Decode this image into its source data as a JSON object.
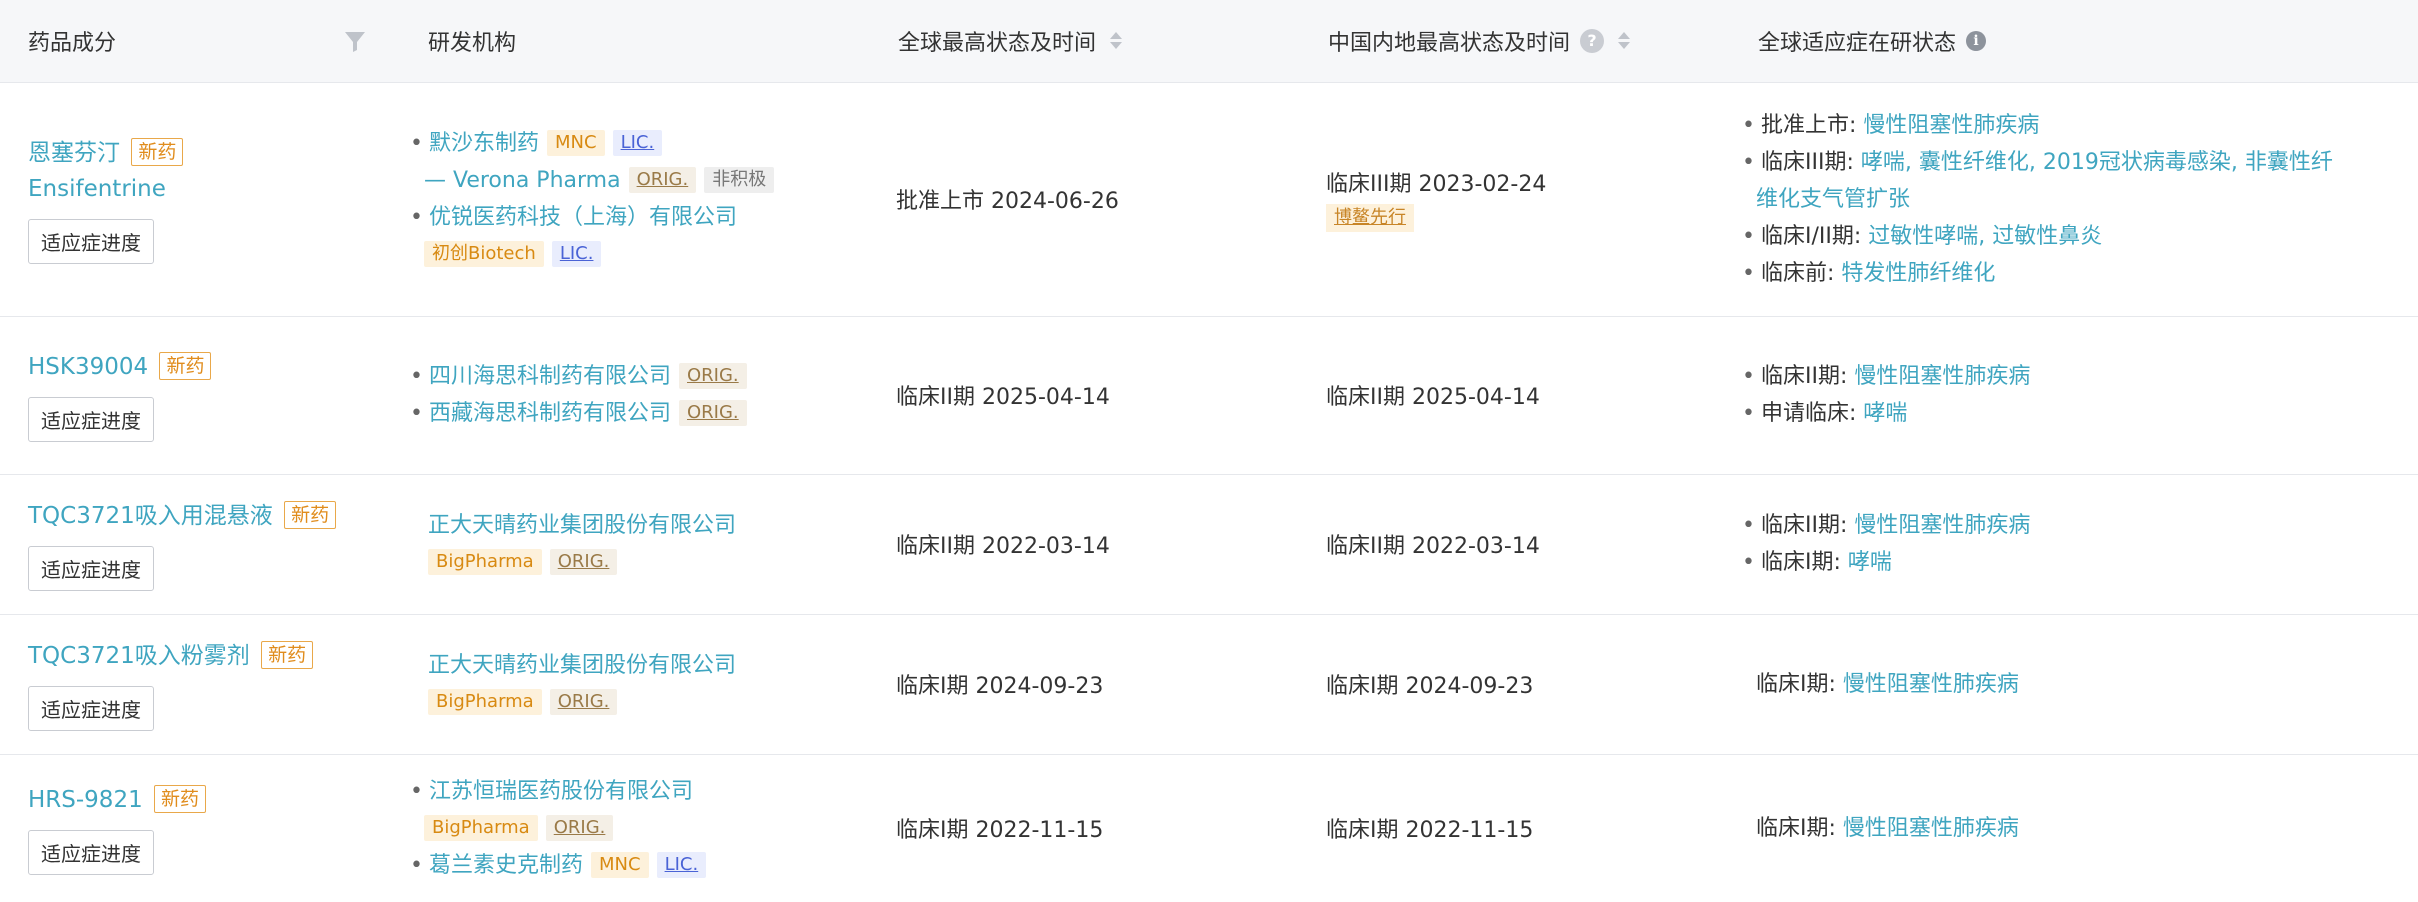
{
  "headers": {
    "drug": "药品成分",
    "org": "研发机构",
    "global_status": "全球最高状态及时间",
    "cn_status": "中国内地最高状态及时间",
    "indication": "全球适应症在研状态"
  },
  "progress_button": "适应症进度",
  "rows": [
    {
      "drug": "恩塞芬汀",
      "drug_en": "Ensifentrine",
      "new_badge": "新药",
      "orgs": [
        {
          "name": "默沙东制药",
          "tags": [
            "MNC",
            "LIC."
          ]
        },
        {
          "name": "— Verona Pharma",
          "tags": [
            "ORIG.",
            "非积极"
          ]
        },
        {
          "name": "优锐医药科技（上海）有限公司",
          "tags": []
        },
        {
          "name": "",
          "tags": [
            "初创Biotech",
            "LIC."
          ]
        }
      ],
      "global_status": "批准上市 2024-06-26",
      "cn_status": "临床III期 2023-02-24",
      "cn_tag": "博鳌先行",
      "indications": [
        {
          "label": "批准上市:",
          "diseases": [
            "慢性阻塞性肺疾病"
          ]
        },
        {
          "label": "临床III期:",
          "diseases": [
            "哮喘,",
            "囊性纤维化,",
            "2019冠状病毒感染,",
            "非囊性纤"
          ]
        },
        {
          "label": "",
          "diseases": [
            "维化支气管扩张"
          ]
        },
        {
          "label": "临床I/II期:",
          "diseases": [
            "过敏性哮喘,",
            "过敏性鼻炎"
          ]
        },
        {
          "label": "临床前:",
          "diseases": [
            "特发性肺纤维化"
          ]
        }
      ]
    },
    {
      "drug": "HSK39004",
      "new_badge": "新药",
      "orgs": [
        {
          "name": "四川海思科制药有限公司",
          "tags": [
            "ORIG."
          ]
        },
        {
          "name": "西藏海思科制药有限公司",
          "tags": [
            "ORIG."
          ]
        }
      ],
      "global_status": "临床II期 2025-04-14",
      "cn_status": "临床II期 2025-04-14",
      "indications": [
        {
          "label": "临床II期:",
          "diseases": [
            "慢性阻塞性肺疾病"
          ]
        },
        {
          "label": "申请临床:",
          "diseases": [
            "哮喘"
          ]
        }
      ]
    },
    {
      "drug": "TQC3721吸入用混悬液",
      "new_badge": "新药",
      "orgs": [
        {
          "name": "正大天晴药业集团股份有限公司",
          "tags": []
        },
        {
          "name": "",
          "tags": [
            "BigPharma",
            "ORIG."
          ]
        }
      ],
      "global_status": "临床II期 2022-03-14",
      "cn_status": "临床II期 2022-03-14",
      "indications": [
        {
          "label": "临床II期:",
          "diseases": [
            "慢性阻塞性肺疾病"
          ]
        },
        {
          "label": "临床I期:",
          "diseases": [
            "哮喘"
          ]
        }
      ]
    },
    {
      "drug": "TQC3721吸入粉雾剂",
      "new_badge": "新药",
      "orgs": [
        {
          "name": "正大天晴药业集团股份有限公司",
          "tags": []
        },
        {
          "name": "",
          "tags": [
            "BigPharma",
            "ORIG."
          ]
        }
      ],
      "global_status": "临床I期 2024-09-23",
      "cn_status": "临床I期 2024-09-23",
      "indications": [
        {
          "label": "临床I期:",
          "diseases": [
            "慢性阻塞性肺疾病"
          ]
        }
      ]
    },
    {
      "drug": "HRS-9821",
      "new_badge": "新药",
      "orgs": [
        {
          "name": "江苏恒瑞医药股份有限公司",
          "tags": []
        },
        {
          "name": "",
          "tags": [
            "BigPharma",
            "ORIG."
          ]
        },
        {
          "name": "葛兰素史克制药",
          "tags": [
            "MNC",
            "LIC."
          ]
        }
      ],
      "global_status": "临床I期 2022-11-15",
      "cn_status": "临床I期 2022-11-15",
      "indications": [
        {
          "label": "临床I期:",
          "diseases": [
            "慢性阻塞性肺疾病"
          ]
        }
      ]
    }
  ]
}
